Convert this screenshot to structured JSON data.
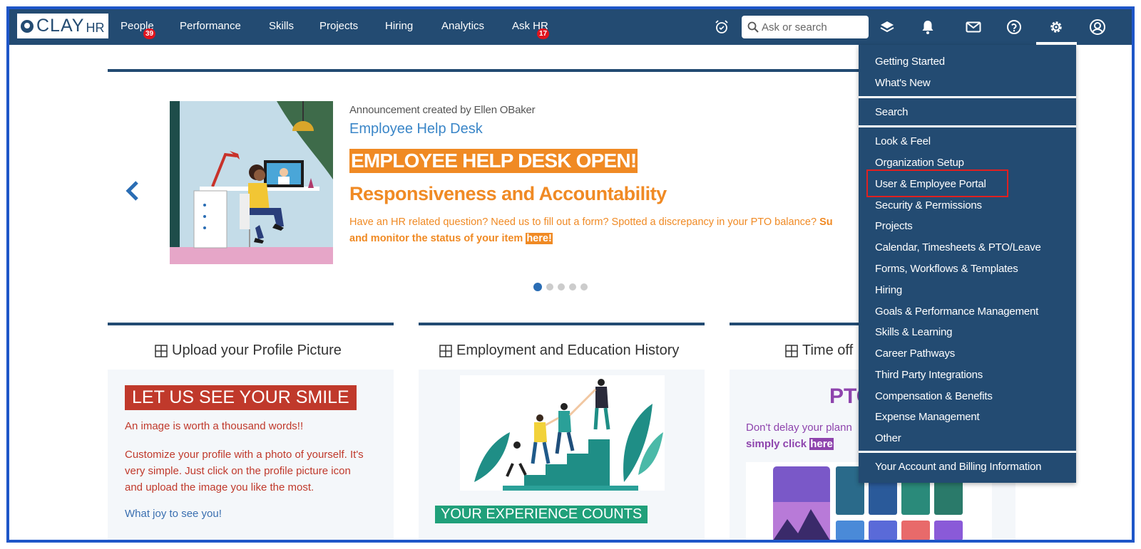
{
  "nav": {
    "logo_clay": "CLAY",
    "logo_hr": "HR",
    "items": [
      {
        "label": "People",
        "badge": "39"
      },
      {
        "label": "Performance"
      },
      {
        "label": "Skills"
      },
      {
        "label": "Projects"
      },
      {
        "label": "Hiring"
      },
      {
        "label": "Analytics"
      },
      {
        "label": "Ask HR",
        "badge": "17"
      }
    ],
    "search_placeholder": "Ask or search",
    "icons": [
      "alarm-clock-icon",
      "layers-icon",
      "bell-icon",
      "mail-icon",
      "help-icon",
      "gear-icon",
      "user-avatar-icon"
    ]
  },
  "announcement": {
    "meta": "Announcement created by Ellen OBaker",
    "title": "Employee Help Desk",
    "banner": "EMPLOYEE HELP DESK OPEN!",
    "subtitle": "Responsiveness and Accountability",
    "body_normal": "Have an HR related question? Need us to fill out a form? Spotted a discrepancy in your PTO balance? ",
    "body_bold": "Su",
    "body_line2": "and monitor the status of your item ",
    "body_link": "here!",
    "dots_total": 5,
    "dots_active": 1
  },
  "cards": [
    {
      "title": "Upload your Profile Picture",
      "banner": "LET US SEE YOUR SMILE",
      "line1": "An image is worth a thousand words!!",
      "para": [
        "Customize your profile with a photo of yourself. It's",
        "very simple. Just click on the profile picture icon",
        "and upload the image you like the most."
      ],
      "footer": "What joy to see you!"
    },
    {
      "title": "Employment and Education History",
      "banner": "YOUR EXPERIENCE COUNTS"
    },
    {
      "title": "Time off",
      "heading": "PTO",
      "line1": "Don't delay your plann",
      "line2": "simply click ",
      "link": "here"
    }
  ],
  "settings_menu": {
    "groups": [
      [
        "Getting Started",
        "What's New"
      ],
      [
        "Search"
      ],
      [
        "Look & Feel",
        "Organization Setup",
        "User & Employee Portal",
        "Security & Permissions",
        "Projects",
        "Calendar, Timesheets & PTO/Leave",
        "Forms, Workflows & Templates",
        "Hiring",
        "Goals & Performance Management",
        "Skills & Learning",
        "Career Pathways",
        "Third Party Integrations",
        "Compensation & Benefits",
        "Expense Management",
        "Other"
      ],
      [
        "Your Account and Billing Information"
      ]
    ],
    "highlighted": "User & Employee Portal"
  },
  "colors": {
    "nav": "#234b72",
    "orange": "#f08a24",
    "red": "#c0392b",
    "purple": "#8e44ad",
    "green": "#20a07a",
    "highlight_border": "#e02020"
  }
}
